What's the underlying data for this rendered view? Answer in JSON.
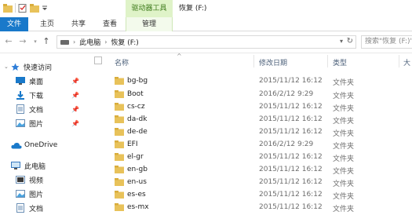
{
  "titlebar": {
    "context_tab_header": "驱动器工具",
    "window_title": "恢复 (F:)"
  },
  "ribbon": {
    "tabs": [
      "文件",
      "主页",
      "共享",
      "查看",
      "管理"
    ]
  },
  "address_bar": {
    "crumbs": [
      "此电脑",
      "恢复 (F:)"
    ],
    "search_placeholder": "搜索\"恢复 (F:)\""
  },
  "nav_pane": {
    "items": [
      {
        "label": "快速访问",
        "icon": "star-icon",
        "pinned": false,
        "level": 0
      },
      {
        "label": "桌面",
        "icon": "desktop-icon",
        "pinned": true,
        "level": 1
      },
      {
        "label": "下载",
        "icon": "download-icon",
        "pinned": true,
        "level": 1
      },
      {
        "label": "文档",
        "icon": "document-icon",
        "pinned": true,
        "level": 1
      },
      {
        "label": "图片",
        "icon": "picture-icon",
        "pinned": true,
        "level": 1
      },
      {
        "label": "OneDrive",
        "icon": "onedrive-icon",
        "pinned": false,
        "level": 0
      },
      {
        "label": "此电脑",
        "icon": "computer-icon",
        "pinned": false,
        "level": 0
      },
      {
        "label": "视频",
        "icon": "video-icon",
        "pinned": false,
        "level": 1
      },
      {
        "label": "图片",
        "icon": "picture-icon",
        "pinned": false,
        "level": 1
      },
      {
        "label": "文档",
        "icon": "document-icon",
        "pinned": false,
        "level": 1
      }
    ]
  },
  "file_list": {
    "columns": [
      "名称",
      "修改日期",
      "类型",
      "大"
    ],
    "rows": [
      {
        "name": "bg-bg",
        "date": "2015/11/12 16:12",
        "type": "文件夹"
      },
      {
        "name": "Boot",
        "date": "2016/2/12 9:29",
        "type": "文件夹"
      },
      {
        "name": "cs-cz",
        "date": "2015/11/12 16:12",
        "type": "文件夹"
      },
      {
        "name": "da-dk",
        "date": "2015/11/12 16:12",
        "type": "文件夹"
      },
      {
        "name": "de-de",
        "date": "2015/11/12 16:12",
        "type": "文件夹"
      },
      {
        "name": "EFI",
        "date": "2016/2/12 9:29",
        "type": "文件夹"
      },
      {
        "name": "el-gr",
        "date": "2015/11/12 16:12",
        "type": "文件夹"
      },
      {
        "name": "en-gb",
        "date": "2015/11/12 16:12",
        "type": "文件夹"
      },
      {
        "name": "en-us",
        "date": "2015/11/12 16:12",
        "type": "文件夹"
      },
      {
        "name": "es-es",
        "date": "2015/11/12 16:12",
        "type": "文件夹"
      },
      {
        "name": "es-mx",
        "date": "2015/11/12 16:12",
        "type": "文件夹"
      }
    ]
  },
  "colors": {
    "file_tab": "#1979ca",
    "context_tab": "#dff3c8",
    "folder": "#e8c25a",
    "header_text": "#4c607a"
  }
}
